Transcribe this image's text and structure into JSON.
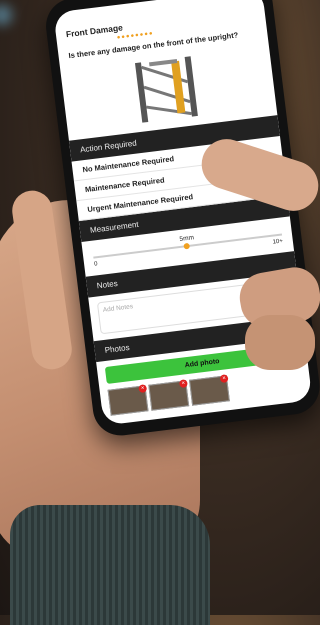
{
  "screen": {
    "title": "Front Damage",
    "progress_dots": "●●●●●●●●",
    "question": "Is there any damage on the front of the upright?",
    "action_required": {
      "header": "Action Required",
      "options": [
        "No Maintenance Required",
        "Maintenance Required",
        "Urgent Maintenance Required"
      ]
    },
    "measurement": {
      "header": "Measurement",
      "value": "5mm",
      "min": "0",
      "max": "10+"
    },
    "notes": {
      "header": "Notes",
      "placeholder": "Add Notes"
    },
    "photos": {
      "header": "Photos",
      "add_label": "Add photo"
    }
  },
  "colors": {
    "accent": "#f0a020",
    "button": "#3cc33c",
    "section_bg": "#222222"
  }
}
